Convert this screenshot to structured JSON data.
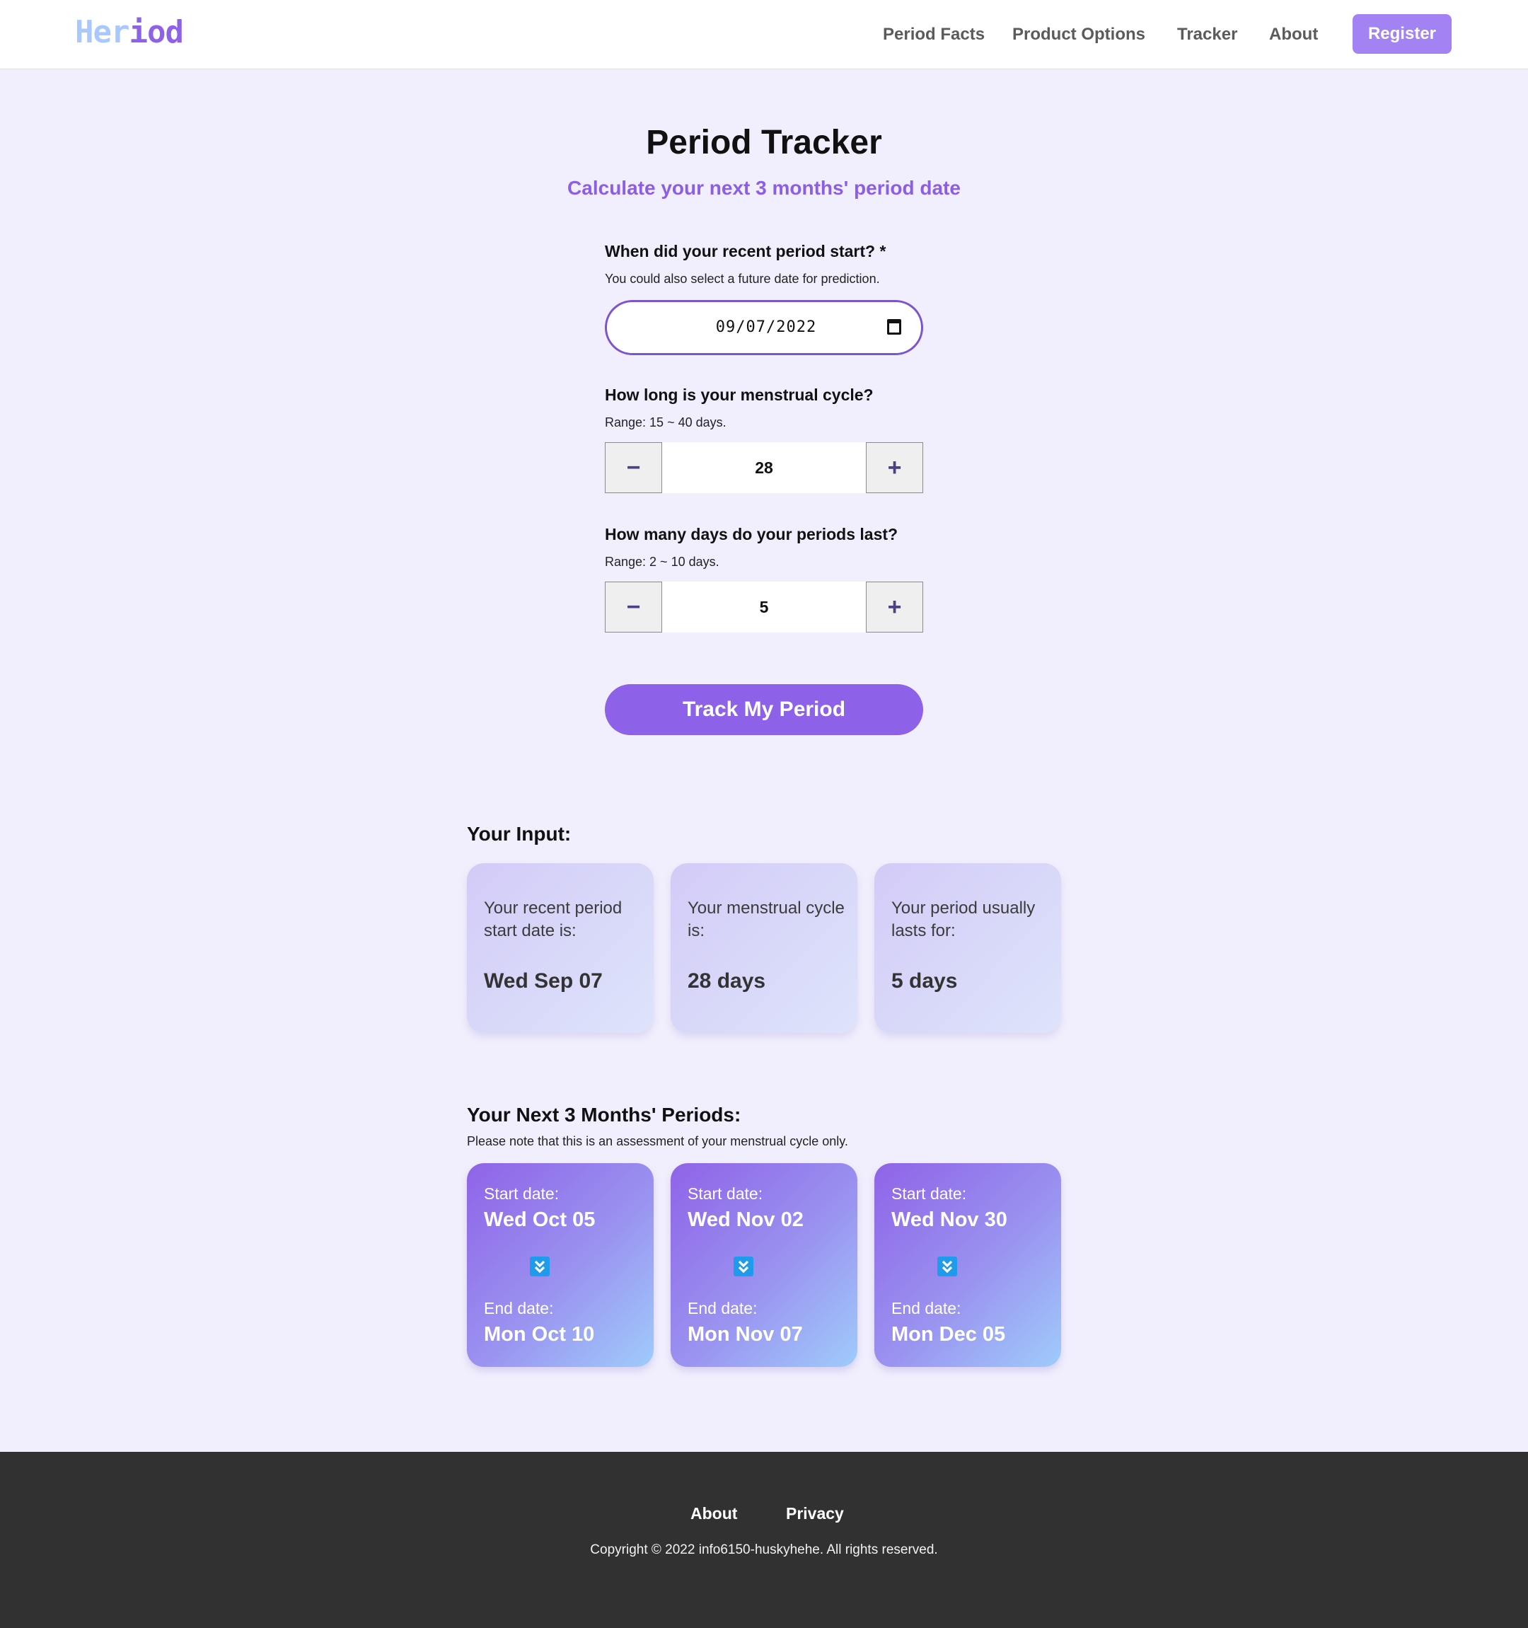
{
  "header": {
    "logo_part1": "Her",
    "logo_part2": "iod",
    "nav": [
      "Period Facts",
      "Product Options",
      "Tracker",
      "About"
    ],
    "register_label": "Register"
  },
  "main": {
    "title": "Period Tracker",
    "subtitle": "Calculate your next 3 months' period date",
    "q1": {
      "label": "When did your recent period start? *",
      "hint": "You could also select a future date for prediction.",
      "value": "09/07/2022"
    },
    "q2": {
      "label": "How long is your menstrual cycle?",
      "hint": "Range: 15 ~ 40 days.",
      "value": "28",
      "minus": "−",
      "plus": "+"
    },
    "q3": {
      "label": "How many days do your periods last?",
      "hint": "Range: 2 ~ 10 days.",
      "value": "5",
      "minus": "−",
      "plus": "+"
    },
    "track_button": "Track My Period"
  },
  "your_input": {
    "title": "Your Input:",
    "cards": [
      {
        "label": "Your recent period start date is:",
        "value": "Wed Sep 07"
      },
      {
        "label": "Your menstrual cycle is:",
        "value": "28 days"
      },
      {
        "label": "Your period usually lasts for:",
        "value": "5 days"
      }
    ]
  },
  "next_periods": {
    "title": "Your Next 3 Months' Periods:",
    "note": "Please note that this is an assessment of your menstrual cycle only.",
    "start_label": "Start date:",
    "end_label": "End date:",
    "cards": [
      {
        "start": "Wed Oct 05",
        "end": "Mon Oct 10"
      },
      {
        "start": "Wed Nov 02",
        "end": "Mon Nov 07"
      },
      {
        "start": "Wed Nov 30",
        "end": "Mon Dec 05"
      }
    ]
  },
  "footer": {
    "links": [
      "About",
      "Privacy"
    ],
    "copyright": "Copyright © 2022 info6150-huskyhehe. All rights reserved."
  },
  "colors": {
    "accent": "#8d62e8",
    "register": "#a382f3",
    "background": "#f1effd",
    "footer": "#313131",
    "icon_blue": "#1e9bea"
  }
}
